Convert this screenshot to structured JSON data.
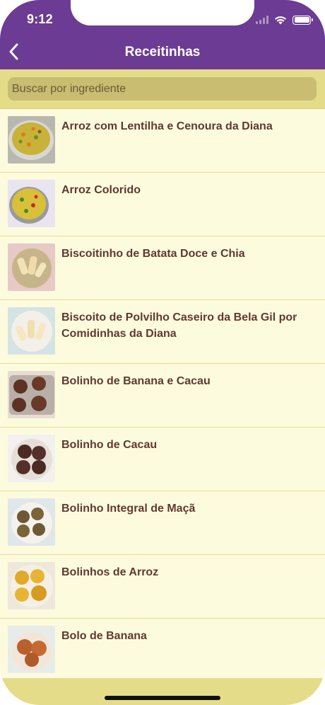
{
  "status_bar": {
    "time": "9:12"
  },
  "nav": {
    "title": "Receitinhas"
  },
  "search": {
    "placeholder": "Buscar por ingrediente",
    "value": ""
  },
  "recipes": [
    {
      "title": "Arroz com Lentilha e Cenoura da Diana",
      "image": "rice-lentil-dish"
    },
    {
      "title": "Arroz Colorido",
      "image": "colorful-rice-dish"
    },
    {
      "title": "Biscoitinho de Batata Doce e Chia",
      "image": "sweet-potato-biscuits"
    },
    {
      "title": "Biscoito de Polvilho Caseiro da Bela Gil por Comidinhas da Diana",
      "image": "polvilho-biscuits"
    },
    {
      "title": "Bolinho de Banana e Cacau",
      "image": "banana-cocoa-muffins"
    },
    {
      "title": "Bolinho de Cacau",
      "image": "cocoa-cookies"
    },
    {
      "title": "Bolinho Integral de Maçã",
      "image": "apple-muffins"
    },
    {
      "title": "Bolinhos de Arroz",
      "image": "rice-balls"
    },
    {
      "title": "Bolo de Banana",
      "image": "banana-cake"
    }
  ],
  "colors": {
    "header": "#6c3b93",
    "search_band": "#e5dc8a",
    "list_background": "#fdfbdd",
    "text": "#5e3a32"
  }
}
